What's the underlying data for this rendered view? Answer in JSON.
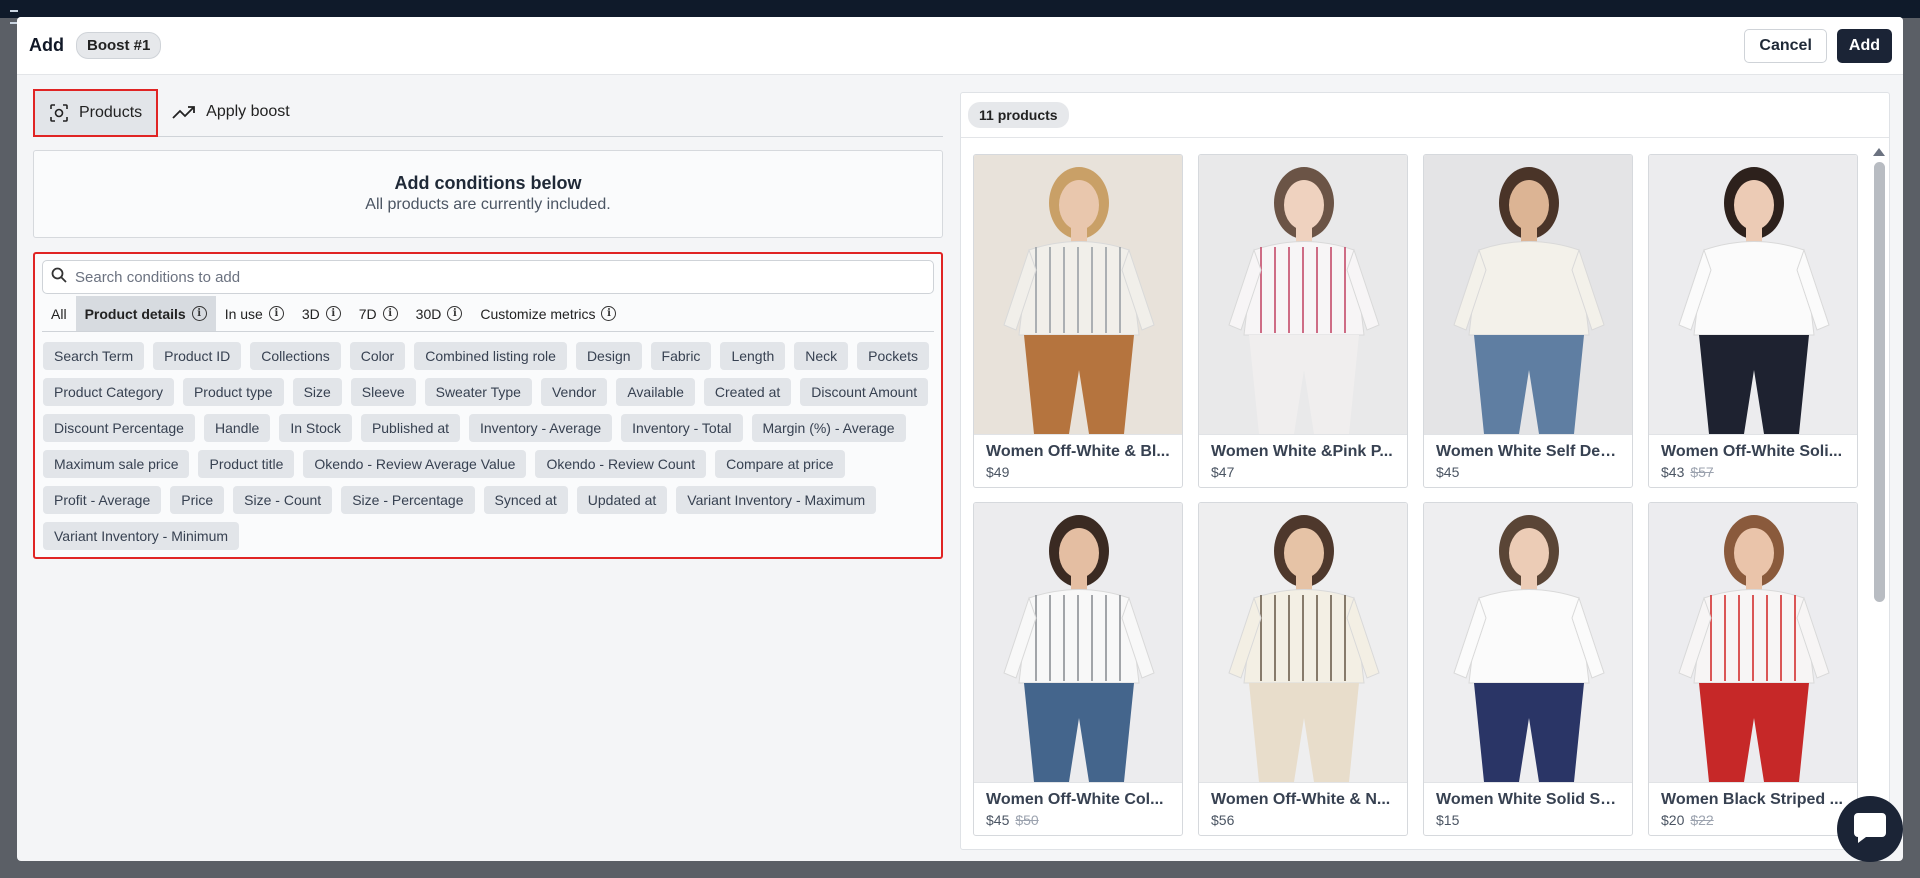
{
  "header": {
    "title": "Add",
    "badge": "Boost #1",
    "cancel_label": "Cancel",
    "add_label": "Add"
  },
  "tabs": [
    {
      "label": "Products",
      "icon": "scan-icon",
      "active": true
    },
    {
      "label": "Apply boost",
      "icon": "trending-up-icon",
      "active": false
    }
  ],
  "conditions_box": {
    "title": "Add conditions below",
    "subtitle": "All products are currently included."
  },
  "search": {
    "placeholder": "Search conditions to add",
    "value": ""
  },
  "filter_tabs": [
    {
      "label": "All"
    },
    {
      "label": "Product details",
      "active": true
    },
    {
      "label": "In use"
    },
    {
      "label": "3D"
    },
    {
      "label": "7D"
    },
    {
      "label": "30D"
    },
    {
      "label": "Customize metrics"
    }
  ],
  "chips": [
    "Search Term",
    "Product ID",
    "Collections",
    "Color",
    "Combined listing role",
    "Design",
    "Fabric",
    "Length",
    "Neck",
    "Pockets",
    "Product Category",
    "Product type",
    "Size",
    "Sleeve",
    "Sweater Type",
    "Vendor",
    "Available",
    "Created at",
    "Discount Amount",
    "Discount Percentage",
    "Handle",
    "In Stock",
    "Published at",
    "Inventory - Average",
    "Inventory - Total",
    "Margin (%) - Average",
    "Maximum sale price",
    "Product title",
    "Okendo - Review Average Value",
    "Okendo - Review Count",
    "Compare at price",
    "Profit - Average",
    "Price",
    "Size - Count",
    "Size - Percentage",
    "Synced at",
    "Updated at",
    "Variant Inventory - Maximum",
    "Variant Inventory - Minimum"
  ],
  "products_panel": {
    "count_label": "11 products"
  },
  "products": [
    {
      "title": "Women Off-White & Bl...",
      "price": "$49",
      "compare": ""
    },
    {
      "title": "Women White &Pink P...",
      "price": "$47",
      "compare": ""
    },
    {
      "title": "Women White Self Des...",
      "price": "$45",
      "compare": ""
    },
    {
      "title": "Women Off-White Soli...",
      "price": "$43",
      "compare": "$57"
    },
    {
      "title": "Women Off-White Col...",
      "price": "$45",
      "compare": "$50"
    },
    {
      "title": "Women Off-White & N...",
      "price": "$56",
      "compare": ""
    },
    {
      "title": "Women White Solid Se...",
      "price": "$15",
      "compare": ""
    },
    {
      "title": "Women Black Striped ...",
      "price": "$20",
      "compare": "$22"
    }
  ],
  "colors": {
    "accent_dark": "#1b2436",
    "highlight_red": "#e02424"
  }
}
